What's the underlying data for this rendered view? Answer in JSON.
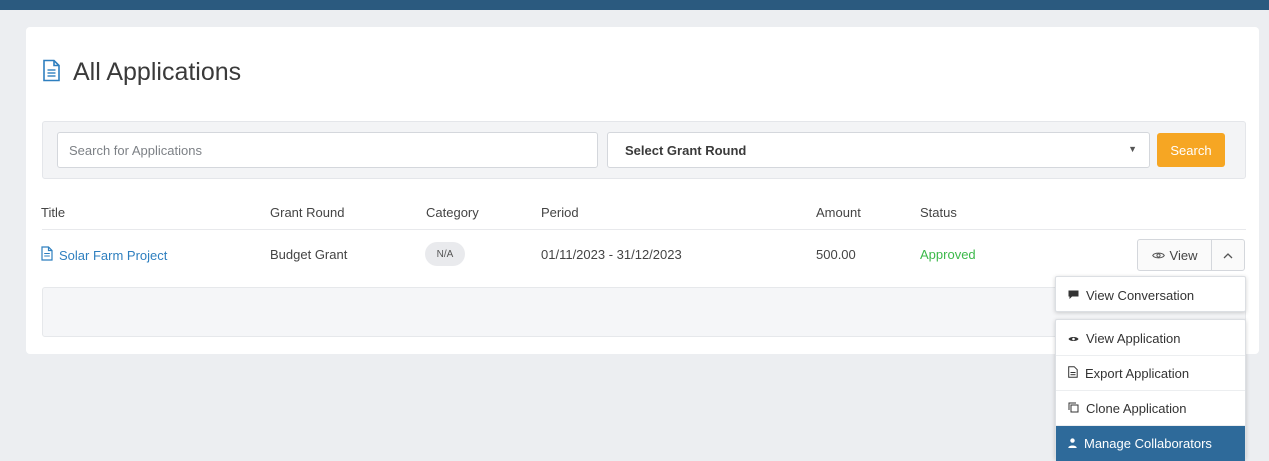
{
  "page": {
    "title": "All Applications"
  },
  "filters": {
    "search_placeholder": "Search for Applications",
    "grant_round_selected": "Select Grant Round",
    "search_button": "Search"
  },
  "table": {
    "columns": [
      "Title",
      "Grant Round",
      "Category",
      "Period",
      "Amount",
      "Status"
    ],
    "rows": [
      {
        "title": "Solar Farm Project",
        "grant_round": "Budget Grant",
        "category": "N/A",
        "period": "01/11/2023 - 31/12/2023",
        "amount": "500.00",
        "status": "Approved"
      }
    ]
  },
  "row_actions": {
    "view_label": "View"
  },
  "dropdown": {
    "top_item": "View Conversation",
    "items": [
      "View Application",
      "Export Application",
      "Clone Application",
      "Manage Collaborators"
    ],
    "active_item": "Manage Collaborators"
  },
  "colors": {
    "topbar": "#2b5a7f",
    "link": "#2e7fbf",
    "approved": "#3cb94a",
    "search_button": "#f6a623",
    "menu_active": "#2e6a9a"
  },
  "icons": {
    "title": "document-icon",
    "row": "document-icon",
    "view": "eye-icon",
    "toggle": "chevron-up-icon",
    "conversation": "chat-bubble-icon",
    "view_application": "eye-icon",
    "export": "export-document-icon",
    "clone": "copy-icon",
    "collaborators": "person-icon"
  }
}
